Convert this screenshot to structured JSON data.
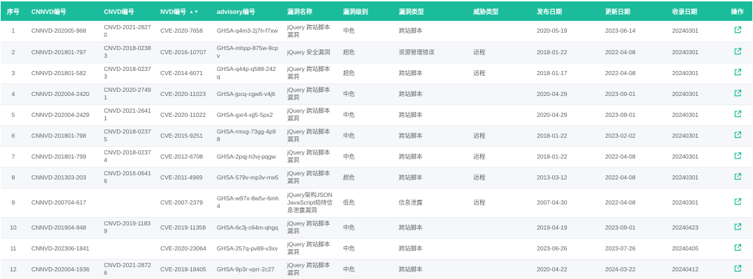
{
  "table": {
    "headers": {
      "seq": "序号",
      "cnnvd": "CNNVD编号",
      "cnvd": "CNVD编号",
      "nvd": "NVD编号",
      "advisory": "advisory编号",
      "vuln_name": "漏洞名称",
      "level": "漏洞级别",
      "vuln_type": "漏洞类型",
      "threat_type": "威胁类型",
      "publish_date": "发布日期",
      "update_date": "更新日期",
      "collect_date": "收录日期",
      "action": "操作"
    },
    "sort_icon": "sort-icon",
    "action_icon": "external-link-icon",
    "accent_color": "#1abc9c",
    "rows": [
      {
        "seq": "1",
        "cnnvd": "CNNVD-202005-968",
        "cnvd": "CNVD-2021-28270",
        "nvd": "CVE-2020-7656",
        "advisory": "GHSA-q4m3-2j7h-f7xw",
        "name": "jQuery 跨站脚本漏洞",
        "level": "中危",
        "vtype": "跨站脚本",
        "threat": "",
        "pub": "2020-05-19",
        "upd": "2023-06-14",
        "col": "20240301"
      },
      {
        "seq": "2",
        "cnnvd": "CNNVD-201801-797",
        "cnvd": "CNVD-2018-02383",
        "nvd": "CVE-2016-10707",
        "advisory": "GHSA-mhpp-875w-9cpv",
        "name": "jQuery 安全漏洞",
        "level": "超危",
        "vtype": "资源管理错误",
        "threat": "远程",
        "pub": "2018-01-22",
        "upd": "2022-04-08",
        "col": "20240301"
      },
      {
        "seq": "3",
        "cnnvd": "CNNVD-201801-582",
        "cnvd": "CNVD-2018-02373",
        "nvd": "CVE-2014-6071",
        "advisory": "GHSA-q44p-q588-242q",
        "name": "jQuery 跨站脚本漏洞",
        "level": "超危",
        "vtype": "跨站脚本",
        "threat": "远程",
        "pub": "2018-01-17",
        "upd": "2022-04-08",
        "col": "20240301"
      },
      {
        "seq": "4",
        "cnnvd": "CNNVD-202004-2420",
        "cnvd": "CNVD-2020-27491",
        "nvd": "CVE-2020-11023",
        "advisory": "GHSA-jpcq-cgw6-v4j6",
        "name": "jQuery 跨站脚本漏洞",
        "level": "中危",
        "vtype": "跨站脚本",
        "threat": "",
        "pub": "2020-04-29",
        "upd": "2023-09-01",
        "col": "20240301"
      },
      {
        "seq": "5",
        "cnnvd": "CNNVD-202004-2429",
        "cnvd": "CNVD-2021-26411",
        "nvd": "CVE-2020-11022",
        "advisory": "GHSA-gxr4-xjj5-5px2",
        "name": "jQuery 跨站脚本漏洞",
        "level": "中危",
        "vtype": "跨站脚本",
        "threat": "",
        "pub": "2020-04-29",
        "upd": "2023-09-01",
        "col": "20240301"
      },
      {
        "seq": "6",
        "cnnvd": "CNNVD-201801-798",
        "cnvd": "CNVD-2018-02375",
        "nvd": "CVE-2015-9251",
        "advisory": "GHSA-rmxg-73gg-4p98",
        "name": "jQuery 跨站脚本漏洞",
        "level": "中危",
        "vtype": "跨站脚本",
        "threat": "远程",
        "pub": "2018-01-22",
        "upd": "2023-02-02",
        "col": "20240301"
      },
      {
        "seq": "7",
        "cnnvd": "CNNVD-201801-799",
        "cnvd": "CNVD-2018-02374",
        "nvd": "CVE-2012-6708",
        "advisory": "GHSA-2pqj-h3vj-pqgw",
        "name": "jQuery 跨站脚本漏洞",
        "level": "中危",
        "vtype": "跨站脚本",
        "threat": "远程",
        "pub": "2018-01-22",
        "upd": "2022-04-08",
        "col": "20240301"
      },
      {
        "seq": "8",
        "cnnvd": "CNNVD-201303-203",
        "cnvd": "CNVD-2016-06416",
        "nvd": "CVE-2011-4969",
        "advisory": "GHSA-579v-mp3v-rrw5",
        "name": "jQuery 跨站脚本漏洞",
        "level": "超危",
        "vtype": "跨站脚本",
        "threat": "远程",
        "pub": "2013-03-12",
        "upd": "2022-04-08",
        "col": "20240301"
      },
      {
        "seq": "9",
        "cnnvd": "CNNVD-200704-617",
        "cnvd": "",
        "nvd": "CVE-2007-2379",
        "advisory": "GHSA-w97x-8w5v-6mh4",
        "name": "jQuery架构JSON JavaScript劫持信息泄露漏洞",
        "level": "低危",
        "vtype": "信息泄露",
        "threat": "远程",
        "pub": "2007-04-30",
        "upd": "2022-04-08",
        "col": "20240301"
      },
      {
        "seq": "10",
        "cnnvd": "CNNVD-201904-948",
        "cnvd": "CNVD-2019-11839",
        "nvd": "CVE-2019-11358",
        "advisory": "GHSA-6c3j-c64m-qhgq",
        "name": "jQuery 跨站脚本漏洞",
        "level": "中危",
        "vtype": "跨站脚本",
        "threat": "",
        "pub": "2019-04-19",
        "upd": "2023-09-01",
        "col": "20240423"
      },
      {
        "seq": "11",
        "cnnvd": "CNNVD-202306-1841",
        "cnvd": "",
        "nvd": "CVE-2020-23064",
        "advisory": "GHSA-257q-pv89-v3xv",
        "name": "jQuery 跨站脚本漏洞",
        "level": "中危",
        "vtype": "跨站脚本",
        "threat": "",
        "pub": "2023-06-26",
        "upd": "2023-07-26",
        "col": "20240405"
      },
      {
        "seq": "12",
        "cnnvd": "CNNVD-202004-1936",
        "cnvd": "CNVD-2021-28726",
        "nvd": "CVE-2018-18405",
        "advisory": "GHSA-9p3r-vprr-2c27",
        "name": "jQuery 跨站脚本漏洞",
        "level": "中危",
        "vtype": "跨站脚本",
        "threat": "",
        "pub": "2020-04-22",
        "upd": "2024-03-22",
        "col": "20240412"
      }
    ]
  }
}
